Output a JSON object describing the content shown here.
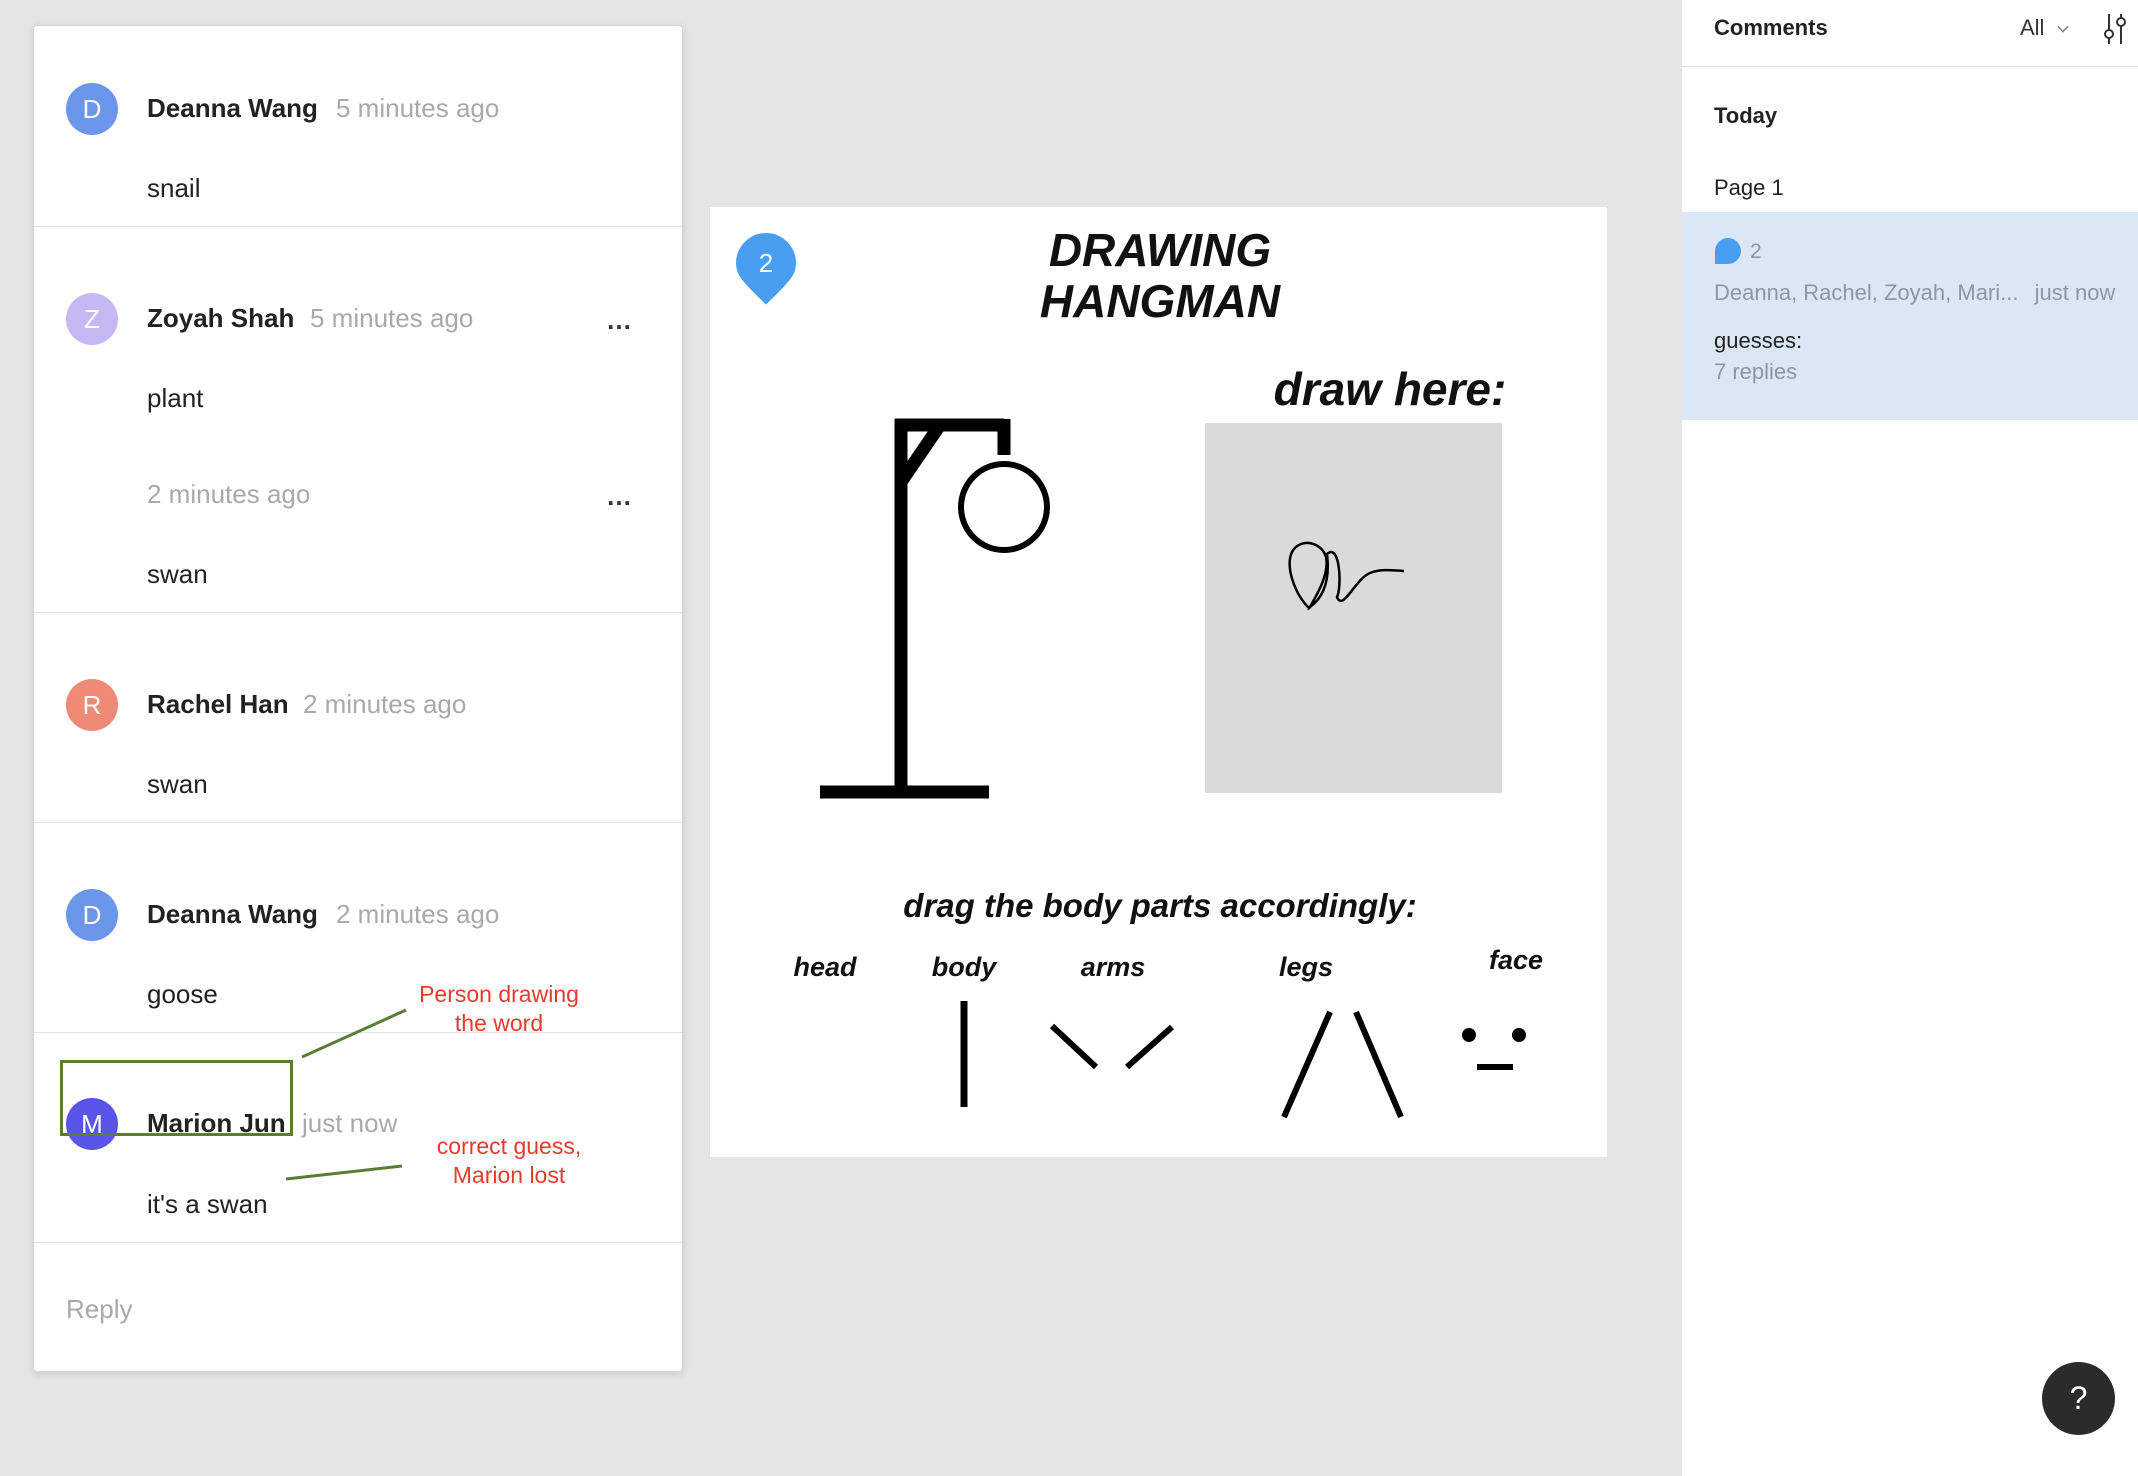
{
  "thread": {
    "comments": [
      {
        "initial": "D",
        "author": "Deanna Wang",
        "time": "5 minutes ago",
        "text": "snail",
        "color": "#6b96ea"
      },
      {
        "initial": "Z",
        "author": "Zoyah Shah",
        "time": "5 minutes ago",
        "text": "plant",
        "color": "#c6b8f2"
      },
      {
        "time": "2 minutes ago",
        "text": "swan"
      },
      {
        "initial": "R",
        "author": "Rachel Han",
        "time": "2 minutes ago",
        "text": "swan",
        "color": "#ee8a75"
      },
      {
        "initial": "D",
        "author": "Deanna Wang",
        "time": "2 minutes ago",
        "text": "goose",
        "color": "#6b96ea"
      },
      {
        "initial": "M",
        "author": "Marion Jun",
        "time": "just now",
        "text": "it's a swan",
        "color": "#5a55e8"
      }
    ],
    "more_icon": "…",
    "reply_placeholder": "Reply"
  },
  "annotations": {
    "drawer": "Person drawing\nthe word",
    "correct": "correct guess,\nMarion lost",
    "box_color": "#5a7d36",
    "text_color": "#e53b2c"
  },
  "canvas": {
    "pin_number": "2",
    "title": "DRAWING\nHANGMAN",
    "draw_here": "draw here:",
    "drag_title": "drag the body parts accordingly:",
    "parts": [
      "head",
      "body",
      "arms",
      "legs",
      "face"
    ],
    "pin_color": "#4a9ef2"
  },
  "sidebar": {
    "title": "Comments",
    "filter": "All",
    "filter_icon": "chevron-down-icon",
    "settings_icon": "tune-icon",
    "section": "Today",
    "page": "Page 1",
    "item": {
      "count": "2",
      "names": "Deanna, Rachel, Zoyah, Mari...",
      "time": "just now",
      "preview": "guesses:",
      "replies": "7 replies"
    }
  },
  "help_label": "?"
}
